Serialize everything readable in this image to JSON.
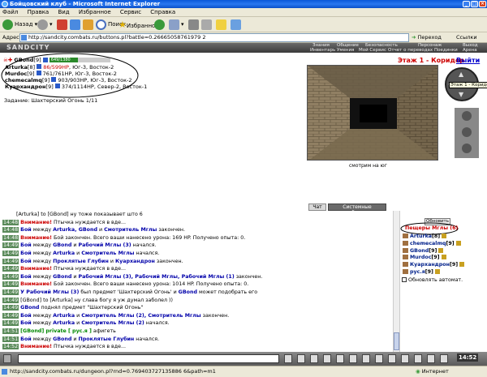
{
  "window": {
    "title": "Бойцовский клуб - Microsoft Internet Explorer"
  },
  "menu": [
    "Файл",
    "Правка",
    "Вид",
    "Избранное",
    "Сервис",
    "Справка"
  ],
  "toolbar": {
    "back": "Назад",
    "search": "Поиск",
    "favorites": "Избранное"
  },
  "address": {
    "label": "Адрес:",
    "url": "http://sandcity.combats.ru/buttons.pl?battle=0.26665058761979 2",
    "go": "Переход",
    "links": "Ссылки"
  },
  "game_header": {
    "logo": "SANDCITY",
    "nav_top": [
      "Знания",
      "Общение",
      "Безопасность",
      "Персонаж",
      "Выход"
    ],
    "nav_bottom": [
      "Инвентарь",
      "Умения",
      "Мой Сервис",
      "Отчет о переводах",
      "Поединки",
      "Арена"
    ]
  },
  "players": {
    "self": {
      "name": "GBond",
      "level": "[9]",
      "hp": "649/1380"
    },
    "list": [
      {
        "name": "Arturka",
        "level": "[8]",
        "hp": "86/599HP",
        "loc": ", Юг-3, Восток-2"
      },
      {
        "name": "Murdoc",
        "level": "[9]",
        "hp": "761/761HP",
        "loc": ", Юг-3, Восток-2"
      },
      {
        "name": "chemecalmq",
        "level": "[9]",
        "hp": "903/903HP",
        "loc": ", Юг-3, Восток-2"
      },
      {
        "name": "Куархандрон",
        "level": "[9]",
        "hp": "374/1114HP",
        "loc": ", Север-2, Восток-1"
      }
    ],
    "quest": "Задание: Шахтерский Огонь 1/11"
  },
  "location": {
    "title": "Этаж 1 - Коридор",
    "exit": "Выйти",
    "tooltip": "Этаж 1 - Коридор",
    "caption": "смотрим на юг"
  },
  "chat_tabs": {
    "chat": "Чат",
    "system": "Системные сообщения"
  },
  "chat": [
    {
      "time": "",
      "parts": [
        {
          "c": "t",
          "x": "[Arturka] to [GBond] ну тоже показывает што 6"
        }
      ]
    },
    {
      "time": "14:48",
      "parts": [
        {
          "c": "rd",
          "x": "Внимание!"
        },
        {
          "c": "t",
          "x": " Птычка нуждается в вде..."
        }
      ]
    },
    {
      "time": "14:48",
      "parts": [
        {
          "c": "bl",
          "x": "Бой"
        },
        {
          "c": "t",
          "x": " между "
        },
        {
          "c": "bl",
          "x": "Arturka, GBond"
        },
        {
          "c": "t",
          "x": " и "
        },
        {
          "c": "bl",
          "x": "Смотритель Мглы"
        },
        {
          "c": "t",
          "x": " закончен."
        }
      ]
    },
    {
      "time": "14:48",
      "parts": [
        {
          "c": "rd",
          "x": "Внимание!"
        },
        {
          "c": "t",
          "x": " Бой закончен. Всего ваши нанесено урона: 169 HP. Получено опыта: 0."
        }
      ]
    },
    {
      "time": "14:49",
      "parts": [
        {
          "c": "bl",
          "x": "Бой"
        },
        {
          "c": "t",
          "x": " между "
        },
        {
          "c": "bl",
          "x": "GBond"
        },
        {
          "c": "t",
          "x": " и "
        },
        {
          "c": "bl",
          "x": "Рабочий Мглы (3)"
        },
        {
          "c": "t",
          "x": " начался."
        }
      ]
    },
    {
      "time": "14:49",
      "parts": [
        {
          "c": "bl",
          "x": "Бой"
        },
        {
          "c": "t",
          "x": " между "
        },
        {
          "c": "bl",
          "x": "Arturka"
        },
        {
          "c": "t",
          "x": " и "
        },
        {
          "c": "bl",
          "x": "Смотритель Мглы"
        },
        {
          "c": "t",
          "x": " начался."
        }
      ]
    },
    {
      "time": "14:49",
      "parts": [
        {
          "c": "bl",
          "x": "Бой"
        },
        {
          "c": "t",
          "x": " между "
        },
        {
          "c": "bl",
          "x": "Проклятые Глубин"
        },
        {
          "c": "t",
          "x": " и "
        },
        {
          "c": "bl",
          "x": "Куархандрон"
        },
        {
          "c": "t",
          "x": " закончен."
        }
      ]
    },
    {
      "time": "14:49",
      "parts": [
        {
          "c": "rd",
          "x": "Внимание!"
        },
        {
          "c": "t",
          "x": " Птычка нуждается в вде..."
        }
      ]
    },
    {
      "time": "14:49",
      "parts": [
        {
          "c": "bl",
          "x": "Бой"
        },
        {
          "c": "t",
          "x": " между "
        },
        {
          "c": "bl",
          "x": "GBond"
        },
        {
          "c": "t",
          "x": " и "
        },
        {
          "c": "bl",
          "x": "Рабочий Мглы (3), Рабочий Мглы, Рабочий Мглы (1)"
        },
        {
          "c": "t",
          "x": " закончен."
        }
      ]
    },
    {
      "time": "14:49",
      "parts": [
        {
          "c": "rd",
          "x": "Внимание!"
        },
        {
          "c": "t",
          "x": " Бой закончен. Всего ваши нанесено урона: 1014 HP. Получено опыта: 0."
        }
      ]
    },
    {
      "time": "14:49",
      "parts": [
        {
          "c": "bl",
          "x": "У Рабочий Мглы (3)"
        },
        {
          "c": "t",
          "x": " был предмет 'Шахтерский Огонь' и "
        },
        {
          "c": "bl",
          "x": "GBond"
        },
        {
          "c": "t",
          "x": " может подобрать его"
        }
      ]
    },
    {
      "time": "14:49",
      "parts": [
        {
          "c": "t",
          "x": "[GBond] to [Arturka] ну слава богу я уж думал заболел ))"
        }
      ]
    },
    {
      "time": "14:49",
      "parts": [
        {
          "c": "bl",
          "x": "GBond"
        },
        {
          "c": "t",
          "x": " поднял предмет \"Шахтерский Огонь\""
        }
      ]
    },
    {
      "time": "14:49",
      "parts": [
        {
          "c": "bl",
          "x": "Бой"
        },
        {
          "c": "t",
          "x": " между "
        },
        {
          "c": "bl",
          "x": "Arturka"
        },
        {
          "c": "t",
          "x": " и "
        },
        {
          "c": "bl",
          "x": "Смотритель Мглы (2), Смотритель Мглы"
        },
        {
          "c": "t",
          "x": " закончен."
        }
      ]
    },
    {
      "time": "14:49",
      "parts": [
        {
          "c": "bl",
          "x": "Бой"
        },
        {
          "c": "t",
          "x": " между "
        },
        {
          "c": "bl",
          "x": "Arturka"
        },
        {
          "c": "t",
          "x": " и "
        },
        {
          "c": "bl",
          "x": "Смотритель Мглы (2)"
        },
        {
          "c": "t",
          "x": " начался."
        }
      ]
    },
    {
      "time": "14:51",
      "parts": [
        {
          "c": "gr",
          "x": "[GBond] private [ рус.я ]"
        },
        {
          "c": "t",
          "x": " афигеть"
        }
      ]
    },
    {
      "time": "14:51",
      "parts": [
        {
          "c": "bl",
          "x": "Бой"
        },
        {
          "c": "t",
          "x": " между "
        },
        {
          "c": "bl",
          "x": "GBond"
        },
        {
          "c": "t",
          "x": " и "
        },
        {
          "c": "bl",
          "x": "Проклятые Глубин"
        },
        {
          "c": "t",
          "x": " начался."
        }
      ]
    },
    {
      "time": "14:52",
      "parts": [
        {
          "c": "rd",
          "x": "Внимание!"
        },
        {
          "c": "t",
          "x": " Птычка нуждается в вде..."
        }
      ]
    },
    {
      "time": "14:52",
      "parts": [
        {
          "c": "bl",
          "x": "Бой"
        },
        {
          "c": "t",
          "x": " между "
        },
        {
          "c": "bl",
          "x": "GBond"
        },
        {
          "c": "t",
          "x": " и "
        },
        {
          "c": "bl",
          "x": "Проклятые Глубин"
        },
        {
          "c": "t",
          "x": " закончен."
        }
      ]
    },
    {
      "time": "14:52",
      "parts": [
        {
          "c": "rd",
          "x": "Внимание!"
        },
        {
          "c": "t",
          "x": " Бой закончен. Всего ваши нанесено урона: 817 HP. Получено опыта: 0."
        }
      ]
    }
  ],
  "right_panel": {
    "refresh": "Обновить",
    "room_title": "Пещеры Мглы (6)",
    "users": [
      {
        "name": "Arturka",
        "level": "[8]"
      },
      {
        "name": "chemecalmq",
        "level": "[9]"
      },
      {
        "name": "GBond",
        "level": "[9]"
      },
      {
        "name": "Murdoc",
        "level": "[9]"
      },
      {
        "name": "Куархандрон",
        "level": "[9]"
      },
      {
        "name": "рус.я",
        "level": "[9]"
      }
    ],
    "auto_refresh": "Обновлять автомат."
  },
  "bottom": {
    "clock": "14:52"
  },
  "status": {
    "url": "http://sandcity.combats.ru/dungeon.pl?rnd=0.769403727135886 6&path=m1",
    "zone": "Интернет"
  }
}
